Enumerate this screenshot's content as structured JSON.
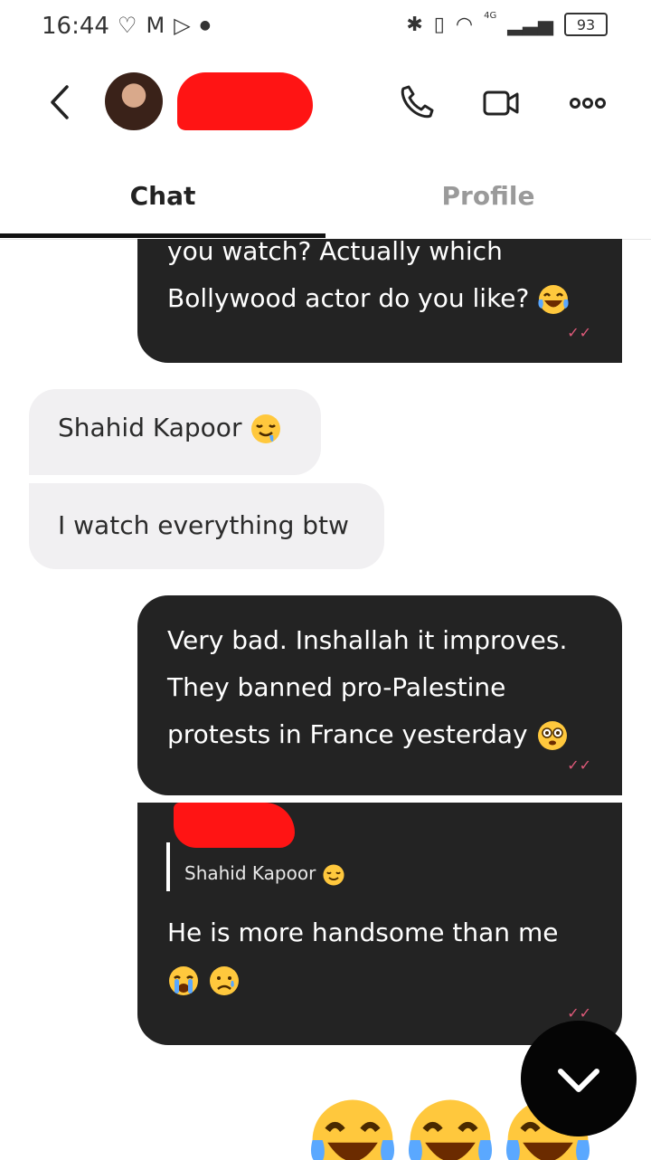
{
  "status_bar": {
    "time": "16:44",
    "network_label": "4G",
    "battery": "93"
  },
  "header": {
    "avatar_alt": "contact avatar",
    "icons": [
      "back-icon",
      "phone-icon",
      "video-icon",
      "more-icon"
    ]
  },
  "tabs": [
    {
      "label": "Chat",
      "active": true
    },
    {
      "label": "Profile",
      "active": false
    }
  ],
  "messages": [
    {
      "side": "out",
      "lines": [
        "you watch? Actually which",
        "Bollywood actor do you like?"
      ],
      "emoji": "laugh-tears"
    },
    {
      "side": "in",
      "text": "Shahid Kapoor",
      "emoji": "drool"
    },
    {
      "side": "in",
      "text": "I watch everything btw"
    },
    {
      "side": "out",
      "lines": [
        "Very bad. Inshallah it improves.",
        "They banned pro-Palestine",
        "protests in France yesterday"
      ],
      "emoji": "flushed"
    },
    {
      "side": "out",
      "reply_to": "Shahid Kapoor",
      "lines": [
        "He is more handsome than me"
      ],
      "emojis": [
        "crying",
        "sad-tear"
      ]
    }
  ],
  "colors": {
    "outgoing_bubble": "#232323",
    "incoming_bubble": "#f1f0f2",
    "read_ticks": "#e05a7a",
    "redaction": "#ff1414"
  }
}
